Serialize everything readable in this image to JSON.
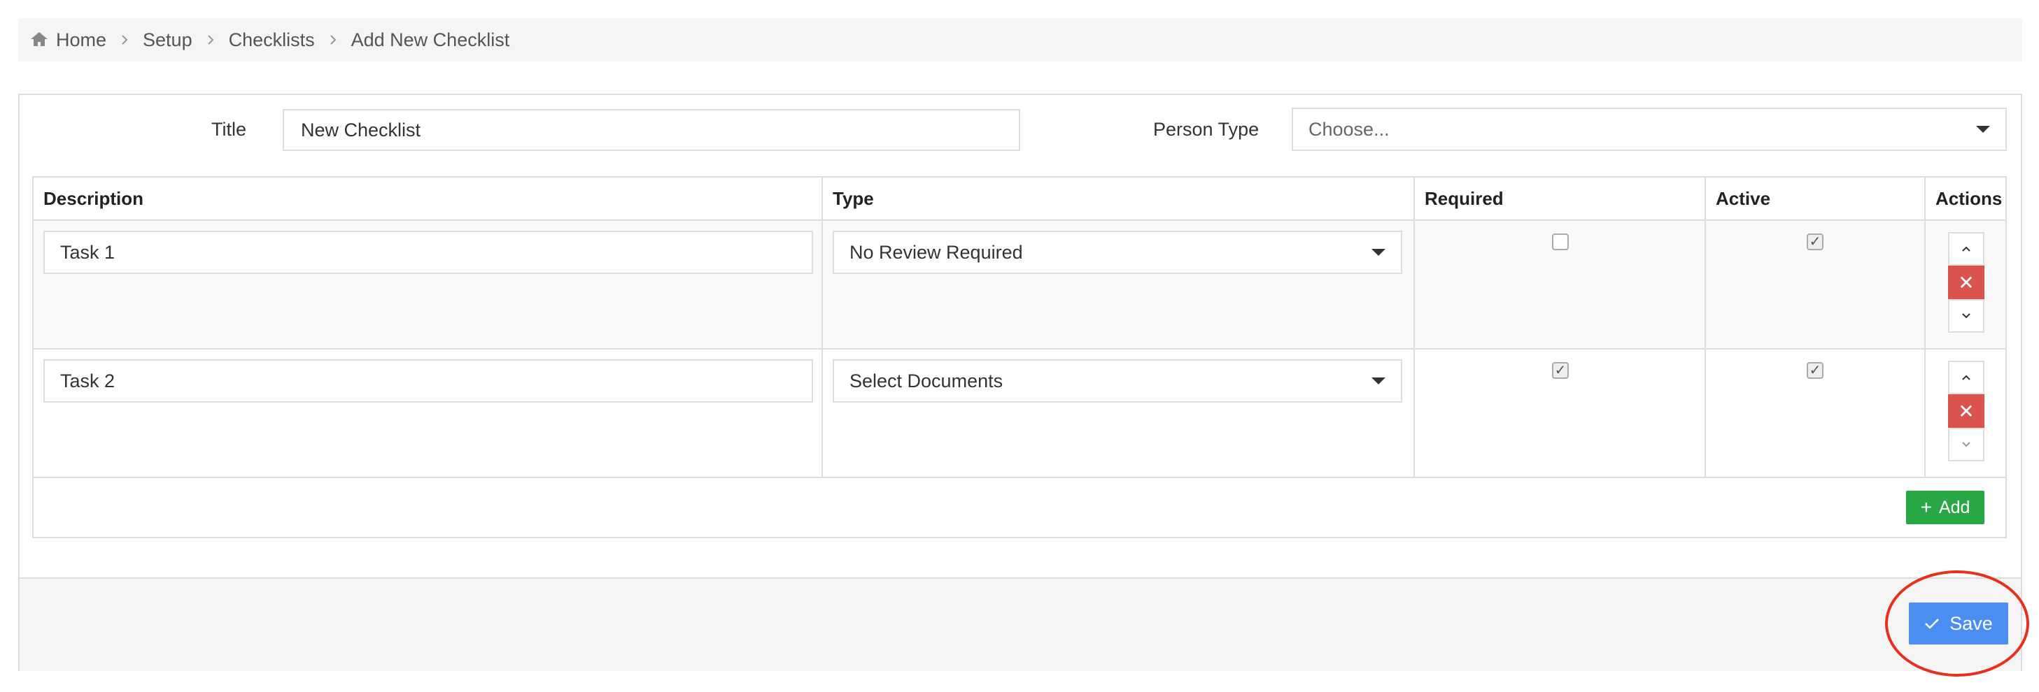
{
  "breadcrumb": {
    "items": [
      {
        "label": "Home",
        "icon": "home-icon"
      },
      {
        "label": "Setup"
      },
      {
        "label": "Checklists"
      },
      {
        "label": "Add New Checklist"
      }
    ]
  },
  "form": {
    "title_label": "Title",
    "title_value": "New Checklist",
    "person_type_label": "Person Type",
    "person_type_placeholder": "Choose..."
  },
  "table": {
    "headers": [
      "Description",
      "Type",
      "Required",
      "Active",
      "Actions"
    ],
    "rows": [
      {
        "description": "Task 1",
        "type": "No Review Required",
        "required": false,
        "active": true
      },
      {
        "description": "Task 2",
        "type": "Select Documents",
        "required": true,
        "active": true
      }
    ],
    "add_label": "Add"
  },
  "footer": {
    "save_label": "Save"
  },
  "colors": {
    "save": "#4a8ef2",
    "add": "#28a745",
    "delete": "#d9534f",
    "highlight": "#e8301c"
  }
}
